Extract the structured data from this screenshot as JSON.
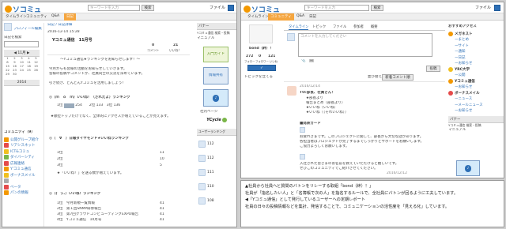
{
  "brand": {
    "name": "ソコミュ"
  },
  "left": {
    "search_placeholder": "キーワードを入力",
    "search_button": "検索",
    "file_menu": "ファイル",
    "nav": [
      "タイムライン",
      "コミュニティ",
      "Q&A",
      "日記"
    ],
    "nav_active": "日記",
    "profile_link": "プロフィール編集",
    "diary_search_label": "日記を検索",
    "calendar": {
      "month": "11月",
      "rows": [
        [
          "1",
          "2",
          "3",
          "4",
          "5",
          "6",
          "7"
        ],
        [
          "8",
          "9",
          "10",
          "11",
          "12",
          "13",
          "14"
        ],
        [
          "15",
          "16",
          "17",
          "18",
          "19",
          "20",
          "21"
        ],
        [
          "22",
          "23",
          "24",
          "25",
          "26",
          "27",
          "28"
        ],
        [
          "29",
          "30",
          "",
          "",
          "",
          "",
          ""
        ]
      ]
    },
    "year_label": "2014",
    "community_title": "コミュニティ（9）",
    "community_items": [
      "公開グループ紹介",
      "リアシスネット",
      "ICT&コミュ",
      "ダイバーシティ",
      "広報連絡",
      "Y'コミュ通信",
      "ボーナスメイル",
      "",
      "ベータ",
      "パンの情報"
    ],
    "breadcrumb": "日記 / 日記詳細",
    "entry_date": "2016-12-14 15:28",
    "entry_title": "Yコミュ通信　11月号",
    "stat_labels": [
      "コメント",
      "いいね！"
    ],
    "stat_values": [
      "0",
      "21"
    ],
    "intro": "〜Yコミュ通信★ランキングをお知らせします！〜",
    "intro_body": [
      "今月からも皆様の活動をお知らせしていきます。",
      "皆様の投稿やコメントが、社員同士の交流を深めています。",
      "引き続き、どんどんYコミュを活用しましょう！"
    ],
    "rank1_title": "◎（ｍ＾ｏ＾ｍ）いいね！（されたよ）ランキング",
    "rank1_rows": [
      [
        "1位",
        "254"
      ],
      [
        "2位",
        "133"
      ],
      [
        "3位",
        "136"
      ]
    ],
    "rank1_note": "★順位トップだけでなく、全体的にアクセスが増えていることが見えます。",
    "rank2_title": "◎（＾∀＾）日報ダイヤモンド★いいねランキング",
    "rank2_rows": [
      [
        "1位",
        "11"
      ],
      [
        "2位",
        "10"
      ],
      [
        "3位",
        "5"
      ]
    ],
    "rank2_note": "★「いいね！」を送る数が増えています。",
    "rank3_title": "◎（(⌒)..）いいね！ランキング",
    "rank3_rows": [
      [
        "1位　今月新規一覧情報",
        "41"
      ],
      [
        "2位　第１回SNMP研修報告",
        "41"
      ],
      [
        "3位　第7回クラウドコンピューティングEXPO報告",
        "41"
      ],
      [
        "4位　Yコミュ通信　10月号",
        "41"
      ]
    ],
    "side": {
      "banner_label": "バナー",
      "banner_text": "Yコミュ通信 検索・投稿",
      "manual_label": "マニュアル",
      "guide_label": "入門ガイド",
      "share_label": "情報共有",
      "help_label": "社内ページ",
      "brand_label": "YCycle",
      "users_label": "ユーザーランキング"
    },
    "users": [
      [
        "112"
      ],
      [
        "112"
      ],
      [
        "111"
      ],
      [
        "110"
      ],
      [
        "108"
      ]
    ]
  },
  "right": {
    "search_placeholder": "キーワードを入力",
    "search_button": "検索",
    "file_menu": "ファイル",
    "nav": [
      "タイムライン",
      "コミュニティ",
      "Q&A",
      "日記"
    ],
    "nav_active": "コミュニティ",
    "profile_name": "bond（絆）！",
    "stats": [
      [
        "272",
        "フォロー"
      ],
      [
        "0",
        "フォロワー"
      ],
      [
        "121",
        "いいね"
      ]
    ],
    "tabs": [
      "タイムライン",
      "トピック",
      "ファイル",
      "参加者",
      "概要"
    ],
    "post_placeholder": "コメントを入力してください",
    "post_button": "投稿",
    "topics_label": "トピックを立てる",
    "sort_label": "並び替え",
    "new_comment_label": "新着コメント順",
    "post_time": "2016/12/14",
    "post_title": "TO:部長、社員さん！",
    "post_lines": [
      "★部長より",
      "報告まとめ（部長より）",
      "★いいね（いいね）",
      "★いいね（（それいいね））"
    ],
    "reply_head": "■発表カード",
    "reply_body": [
      "お疲れさまです。このプロジェクトに関して、部長から大切な話があります。",
      "各担当者はプロジェクトが完了するまでしっかりとサポートをお願いします。",
      "ご協力よろしくお願いします。"
    ],
    "reply2_body": [
      "入社された皆さまのお名前を教えていただけると嬉しいです。",
      "ぜひこのコミュニティでご紹介させてください。"
    ],
    "reply2_time": "2016/12/12",
    "side": {
      "recommend_title": "おすすめアクセス",
      "items": [
        "メガネスト",
        "ーまとめ",
        "ーサイト",
        "ー通知",
        "ー日記",
        "ーお知らせ",
        "YRC大学",
        "ー公開",
        "Yコミュ通信",
        "ーお知らせ",
        "ボーナスメイル",
        "ーニュース",
        "ーメールニュース",
        "ーお知らせ"
      ],
      "banner_label": "バナー",
      "banner_text": "Yコミュ通信 検索・投稿",
      "manual_label": "マニュアル"
    }
  },
  "caption": {
    "line1": "▲社員から社員へと質問のバトンをリレーする取組「bond（絆）！」",
    "line2": "社員が「指名したい人」と「名簿帳で次の人」を指名するルールで、全社員にバトンが回るように工夫しています。",
    "line3": "◀「Yコミュ通信」として発行しているユーザーへの定期レポート",
    "line4": "社員の日々の投稿情報などを集計、発信することで、コミュニケーションの活性度を「見える化」しています。"
  }
}
